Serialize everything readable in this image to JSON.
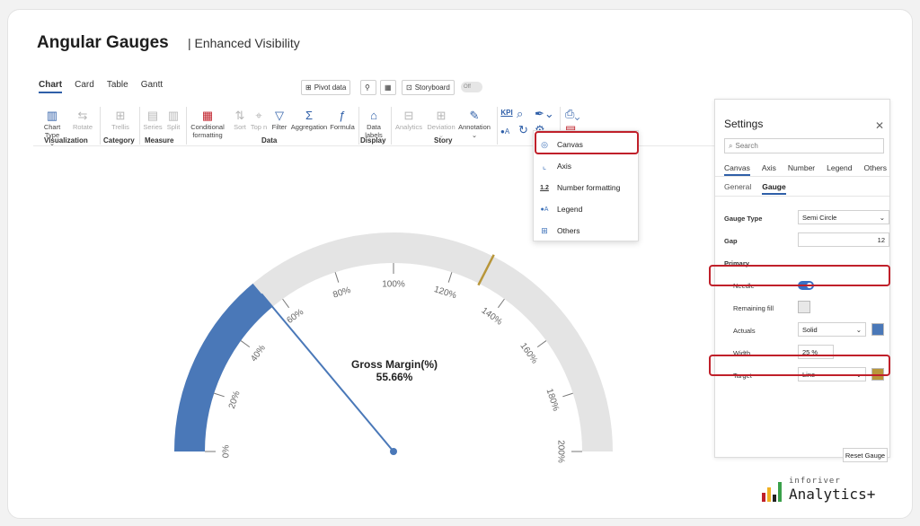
{
  "header": {
    "title": "Angular Gauges",
    "subtitle": "| Enhanced Visibility"
  },
  "ribbon": {
    "tabs": [
      "Chart",
      "Card",
      "Table",
      "Gantt"
    ],
    "top_buttons": {
      "pivot": "Pivot data",
      "storyboard": "Storyboard",
      "toggle": "Off"
    },
    "items": {
      "chart_type": "Chart Type",
      "rotate": "Rotate",
      "trellis": "Trellis",
      "series": "Series",
      "split": "Split",
      "conditional": "Conditional",
      "formatting": "formatting",
      "sort": "Sort",
      "topn": "Top n",
      "filter": "Filter",
      "aggregation": "Aggregation",
      "formula": "Formula",
      "data": "Data",
      "labels": "labels",
      "analytics": "Analytics",
      "deviation": "Deviation",
      "annotation": "Annotation",
      "kpi": "KPI"
    },
    "groups": [
      "Visualization",
      "Category",
      "Measure",
      "Data",
      "Display",
      "Story"
    ]
  },
  "dropdown": {
    "items": [
      "Canvas",
      "Axis",
      "Number formatting",
      "Legend",
      "Others"
    ],
    "num_icon": "1.2"
  },
  "settings": {
    "title": "Settings",
    "search_placeholder": "Search",
    "tabs": [
      "Canvas",
      "Axis",
      "Number",
      "Legend",
      "Others"
    ],
    "subtabs": [
      "General",
      "Gauge"
    ],
    "gauge_type_label": "Gauge Type",
    "gauge_type_value": "Semi Circle",
    "gap_label": "Gap",
    "gap_value": "12",
    "primary_label": "Primary",
    "needle_label": "Needle",
    "remaining_fill_label": "Remaining fill",
    "actuals_label": "Actuals",
    "actuals_value": "Solid",
    "width_label": "Width",
    "width_value": "25 %",
    "target_label": "Target",
    "target_value": "Line",
    "reset_label": "Reset Gauge",
    "colors": {
      "actuals": "#4a78b8",
      "target": "#b8963a",
      "remaining": "#e8e8e8"
    }
  },
  "chart_data": {
    "type": "gauge",
    "title": "Gross Margin(%)",
    "value": 55.66,
    "value_label": "55.66%",
    "target": 130,
    "min": 0,
    "max": 200,
    "ticks": [
      "0%",
      "20%",
      "40%",
      "60%",
      "80%",
      "100%",
      "120%",
      "140%",
      "160%",
      "180%",
      "200%"
    ],
    "colors": {
      "actual": "#4a78b8",
      "track": "#e4e4e4",
      "target": "#b8963a",
      "needle": "#4a78b8"
    }
  },
  "logo": {
    "top": "inforiver",
    "bottom": "Analytics+"
  }
}
